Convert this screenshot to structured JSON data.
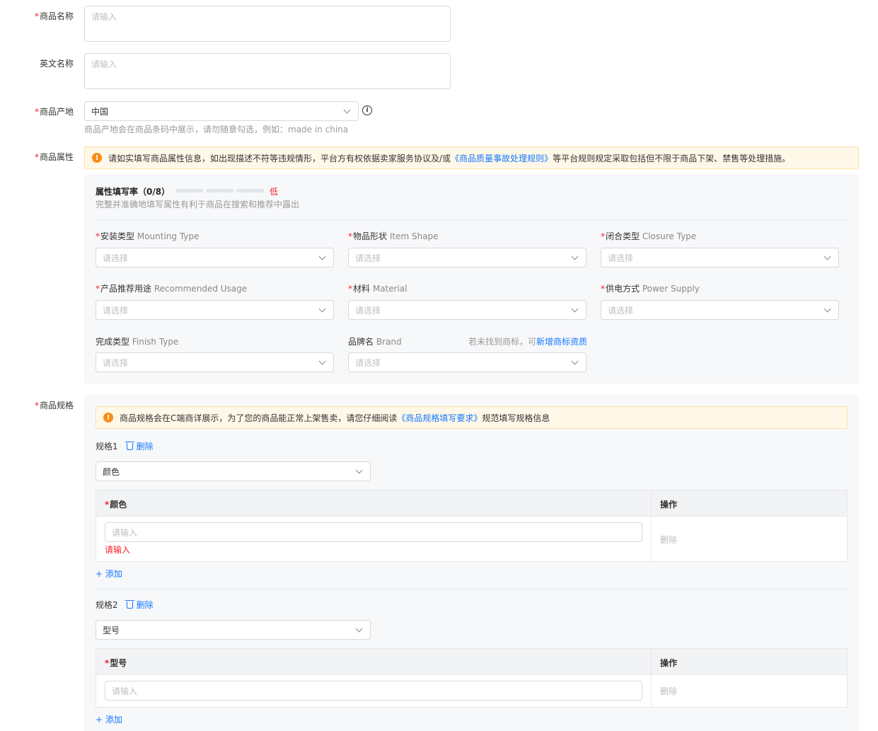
{
  "form": {
    "product_name": {
      "label": "商品名称",
      "placeholder": "请输入"
    },
    "english_name": {
      "label": "英文名称",
      "placeholder": "请输入"
    },
    "origin": {
      "label": "商品产地",
      "value": "中国",
      "hint": "商品产地会在商品条码中展示，请勿随意勾选，例如：made in china"
    },
    "attributes": {
      "label": "商品属性",
      "alert_pre": "请如实填写商品属性信息，如出现描述不符等违规情形，平台方有权依据卖家服务协议及/或",
      "alert_link": "《商品质量事故处理规则》",
      "alert_post": "等平台规则规定采取包括但不限于商品下架、禁售等处理措施。",
      "rate_title": "属性填写率（0/8）",
      "rate_level": "低",
      "rate_hint": "完整并准确地填写属性有利于商品在搜索和推荐中露出",
      "fields": [
        {
          "cn": "安装类型",
          "en": "Mounting Type",
          "placeholder": "请选择"
        },
        {
          "cn": "物品形状",
          "en": "Item Shape",
          "placeholder": "请选择"
        },
        {
          "cn": "闭合类型",
          "en": "Closure Type",
          "placeholder": "请选择"
        },
        {
          "cn": "产品推荐用途",
          "en": "Recommended Usage",
          "placeholder": "请选择"
        },
        {
          "cn": "材料",
          "en": "Material",
          "placeholder": "请选择"
        },
        {
          "cn": "供电方式",
          "en": "Power Supply",
          "placeholder": "请选择"
        },
        {
          "cn": "完成类型",
          "en": "Finish Type",
          "placeholder": "请选择"
        },
        {
          "cn": "品牌名",
          "en": "Brand",
          "placeholder": "请选择"
        }
      ],
      "brand_hint": "若未找到商标，可",
      "brand_link": "新增商标资质"
    },
    "specs": {
      "label": "商品规格",
      "alert_pre": "商品规格会在C端商详展示，为了您的商品能正常上架售卖，请您仔细阅读",
      "alert_link": "《商品规格填写要求》",
      "alert_post": "规范填写规格信息",
      "delete_label": "删除",
      "add_label": "+ 添加",
      "op_header": "操作",
      "input_placeholder": "请输入",
      "items": [
        {
          "title": "规格1",
          "value": "颜色",
          "column": "颜色",
          "error": "请输入"
        },
        {
          "title": "规格2",
          "value": "型号",
          "column": "型号"
        }
      ]
    }
  },
  "colors": {
    "link": "#1677ff",
    "required": "#f5222d",
    "warn": "#fa8c16"
  }
}
